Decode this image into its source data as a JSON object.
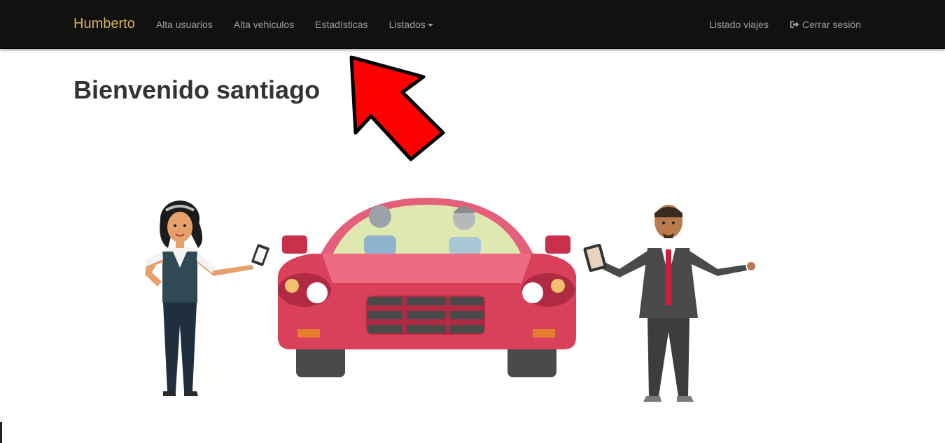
{
  "navbar": {
    "brand": "Humberto",
    "items": [
      {
        "label": "Alta usuarios"
      },
      {
        "label": "Alta vehiculos"
      },
      {
        "label": "Estadísticas"
      },
      {
        "label": "Listados",
        "dropdown": true
      }
    ],
    "right_items": [
      {
        "label": "Listado viajes"
      },
      {
        "label": "Cerrar sesión",
        "icon": "logout-icon"
      }
    ]
  },
  "main": {
    "heading": "Bienvenido santiago"
  },
  "colors": {
    "navbar_bg": "#111111",
    "brand": "#d9b358",
    "nav_link": "#9d9d9d",
    "heading": "#333333",
    "car_body": "#d9415a",
    "annotation_arrow": "#ff0000"
  }
}
